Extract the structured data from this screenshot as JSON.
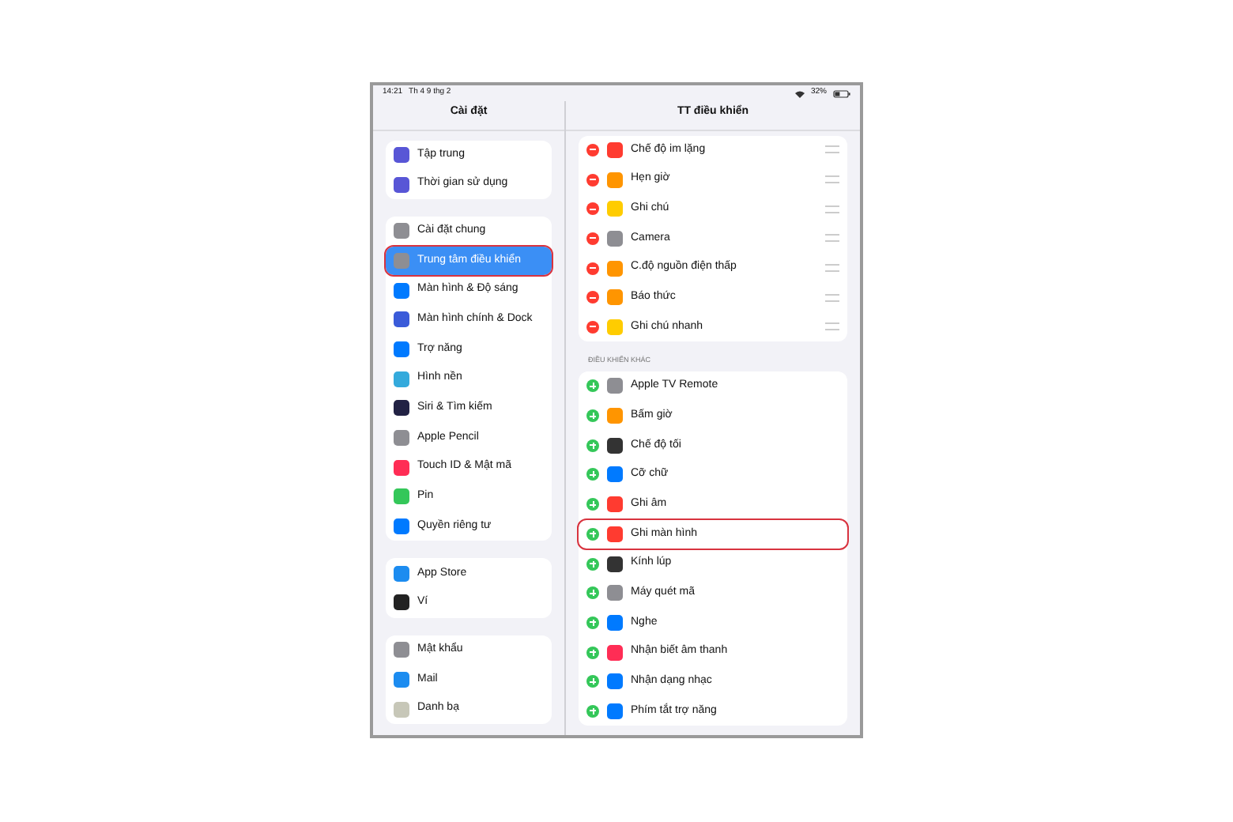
{
  "status_bar": {
    "time": "14:21",
    "date": "Th 4 9 thg 2",
    "battery": "32%"
  },
  "sidebar": {
    "title": "Cài đặt",
    "groups": [
      {
        "items": [
          {
            "label": "Tập trung",
            "color": "#5856d6",
            "selected": false,
            "highlighted": false
          },
          {
            "label": "Thời gian sử dụng",
            "color": "#5856d6",
            "selected": false,
            "highlighted": false
          }
        ]
      },
      {
        "items": [
          {
            "label": "Cài đặt chung",
            "color": "#8e8e93",
            "selected": false,
            "highlighted": false
          },
          {
            "label": "Trung tâm điều khiển",
            "color": "#8e8e93",
            "selected": true,
            "highlighted": true
          },
          {
            "label": "Màn hình & Độ sáng",
            "color": "#007aff",
            "selected": false,
            "highlighted": false
          },
          {
            "label": "Màn hình chính & Dock",
            "color": "#3a5bd9",
            "selected": false,
            "highlighted": false
          },
          {
            "label": "Trợ năng",
            "color": "#007aff",
            "selected": false,
            "highlighted": false
          },
          {
            "label": "Hình nền",
            "color": "#34aadc",
            "selected": false,
            "highlighted": false
          },
          {
            "label": "Siri & Tìm kiếm",
            "color": "#222244",
            "selected": false,
            "highlighted": false
          },
          {
            "label": "Apple Pencil",
            "color": "#8e8e93",
            "selected": false,
            "highlighted": false
          },
          {
            "label": "Touch ID & Mật mã",
            "color": "#ff2d55",
            "selected": false,
            "highlighted": false
          },
          {
            "label": "Pin",
            "color": "#34c759",
            "selected": false,
            "highlighted": false
          },
          {
            "label": "Quyền riêng tư",
            "color": "#007aff",
            "selected": false,
            "highlighted": false
          }
        ]
      },
      {
        "items": [
          {
            "label": "App Store",
            "color": "#1c8cf0",
            "selected": false,
            "highlighted": false
          },
          {
            "label": "Ví",
            "color": "#222222",
            "selected": false,
            "highlighted": false
          }
        ]
      },
      {
        "items": [
          {
            "label": "Mật khẩu",
            "color": "#8e8e93",
            "selected": false,
            "highlighted": false
          },
          {
            "label": "Mail",
            "color": "#1c8cf0",
            "selected": false,
            "highlighted": false
          },
          {
            "label": "Danh bạ",
            "color": "#c7c7b8",
            "selected": false,
            "highlighted": false
          }
        ]
      }
    ]
  },
  "panel": {
    "title": "TT điều khiển",
    "sections": [
      {
        "kind": "included",
        "items": [
          {
            "label": "Chế độ im lặng",
            "color": "#ff3b30",
            "highlighted": false
          },
          {
            "label": "Hẹn giờ",
            "color": "#ff9500",
            "highlighted": false
          },
          {
            "label": "Ghi chú",
            "color": "#ffcc00",
            "highlighted": false
          },
          {
            "label": "Camera",
            "color": "#8e8e93",
            "highlighted": false
          },
          {
            "label": "C.độ nguồn điện thấp",
            "color": "#ff9500",
            "highlighted": false
          },
          {
            "label": "Báo thức",
            "color": "#ff9500",
            "highlighted": false
          },
          {
            "label": "Ghi chú nhanh",
            "color": "#ffcc00",
            "highlighted": false
          }
        ]
      },
      {
        "kind": "more",
        "header": "ĐIỀU KHIỂN KHÁC",
        "items": [
          {
            "label": "Apple TV Remote",
            "color": "#8e8e93",
            "highlighted": false
          },
          {
            "label": "Bấm giờ",
            "color": "#ff9500",
            "highlighted": false
          },
          {
            "label": "Chế độ tối",
            "color": "#333333",
            "highlighted": false
          },
          {
            "label": "Cỡ chữ",
            "color": "#007aff",
            "highlighted": false
          },
          {
            "label": "Ghi âm",
            "color": "#ff3b30",
            "highlighted": false
          },
          {
            "label": "Ghi màn hình",
            "color": "#ff3b30",
            "highlighted": true
          },
          {
            "label": "Kính lúp",
            "color": "#333333",
            "highlighted": false
          },
          {
            "label": "Máy quét mã",
            "color": "#8e8e93",
            "highlighted": false
          },
          {
            "label": "Nghe",
            "color": "#007aff",
            "highlighted": false
          },
          {
            "label": "Nhận biết âm thanh",
            "color": "#ff2d55",
            "highlighted": false
          },
          {
            "label": "Nhận dạng nhạc",
            "color": "#007aff",
            "highlighted": false
          },
          {
            "label": "Phím tắt trợ năng",
            "color": "#007aff",
            "highlighted": false
          }
        ]
      }
    ]
  }
}
